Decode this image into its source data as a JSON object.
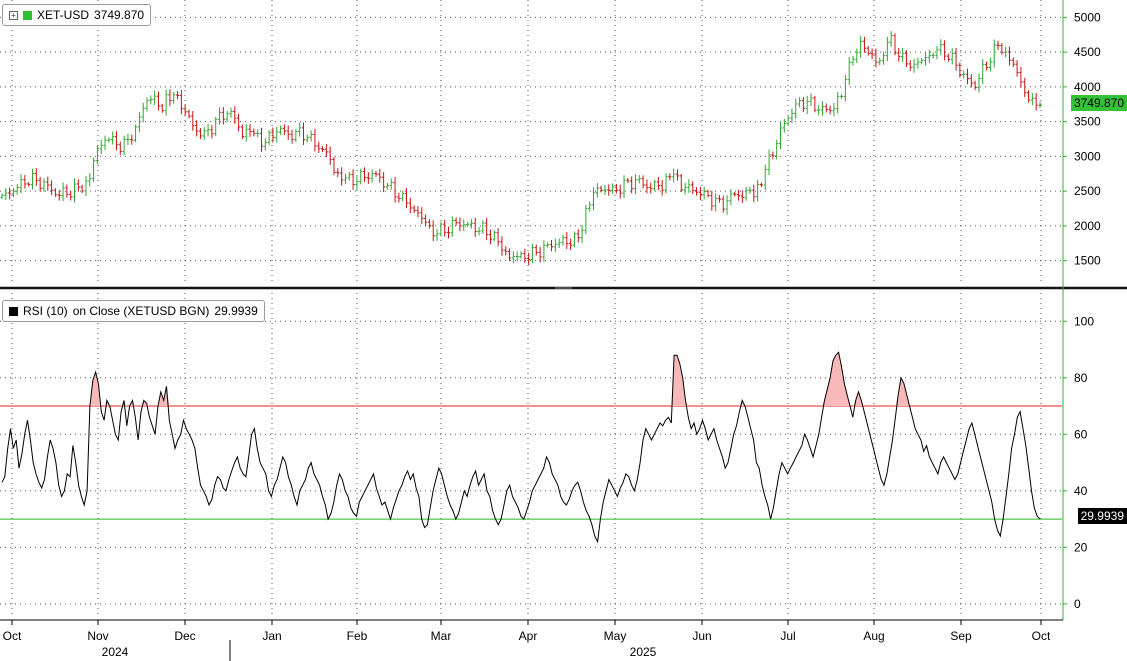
{
  "chart_data": [
    {
      "type": "candlestick",
      "legend": {
        "label": "XET-USD",
        "last_value": "3749.870",
        "color": "#2fc12f"
      },
      "last_tag": "3749.870",
      "ylim": [
        1150,
        5250
      ],
      "yticks": [
        1500,
        2000,
        2500,
        3000,
        3500,
        4000,
        4500,
        5000
      ],
      "up_color": "#2fa82f",
      "down_color": "#c81414",
      "x_points_per_month": 22,
      "close_series_monthly_anchors": [
        {
          "month": "Oct 2024",
          "values": [
            2400,
            2550,
            2680,
            2600,
            2450,
            2500
          ]
        },
        {
          "month": "Nov 2024",
          "values": [
            2600,
            3050,
            3300,
            3150,
            3200,
            3500,
            3900,
            3700
          ]
        },
        {
          "month": "Dec 2024",
          "values": [
            3900,
            3750,
            3400,
            3300,
            3550,
            3650,
            3350
          ]
        },
        {
          "month": "Jan 2025",
          "values": [
            3300,
            3200,
            3400,
            3300,
            3350,
            3200,
            3050
          ]
        },
        {
          "month": "Feb 2025",
          "values": [
            2750,
            2650,
            2700,
            2750,
            2600,
            2450,
            2300
          ]
        },
        {
          "month": "Mar 2025",
          "values": [
            2100,
            1900,
            1950,
            2050,
            2000,
            1950,
            1850
          ]
        },
        {
          "month": "Apr 2025",
          "values": [
            1600,
            1550,
            1580,
            1650,
            1750,
            1780,
            1800
          ]
        },
        {
          "month": "May 2025",
          "values": [
            2400,
            2550,
            2500,
            2600,
            2650,
            2550,
            2600
          ]
        },
        {
          "month": "Jun 2025",
          "values": [
            2700,
            2550,
            2500,
            2400,
            2300,
            2450,
            2450
          ]
        },
        {
          "month": "Jul 2025",
          "values": [
            2550,
            2950,
            3400,
            3700,
            3800,
            3700,
            3650
          ]
        },
        {
          "month": "Aug 2025",
          "values": [
            3900,
            4500,
            4600,
            4300,
            4700,
            4400,
            4300
          ]
        },
        {
          "month": "Sep 2025",
          "values": [
            4400,
            4550,
            4450,
            4200,
            4000,
            4300,
            4600
          ]
        },
        {
          "month": "Oct 2025",
          "values": [
            4450,
            4050,
            3749.87
          ]
        }
      ]
    },
    {
      "type": "line",
      "legend": {
        "label": "RSI (10)",
        "source": "on Close (XETUSD BGN)",
        "last_value": "29.9939",
        "color": "#000000"
      },
      "last_tag": "29.9939",
      "ylim": [
        -5,
        110
      ],
      "yticks": [
        0,
        20,
        40,
        60,
        80,
        100
      ],
      "overbought": 70,
      "oversold": 30,
      "overbought_color": "#e02020",
      "oversold_color": "#22bb22",
      "fill_color": "#f7b9b9",
      "rsi_values": [
        43,
        45,
        55,
        62,
        55,
        58,
        48,
        53,
        60,
        65,
        58,
        50,
        46,
        43,
        41,
        44,
        52,
        58,
        55,
        50,
        42,
        38,
        40,
        46,
        45,
        56,
        50,
        42,
        38,
        35,
        40,
        70,
        79,
        82,
        78,
        68,
        65,
        72,
        70,
        65,
        60,
        58,
        68,
        72,
        63,
        70,
        72,
        66,
        58,
        68,
        72,
        71,
        66,
        63,
        60,
        70,
        75,
        72,
        77,
        65,
        60,
        55,
        58,
        60,
        65,
        62,
        60,
        58,
        55,
        48,
        42,
        40,
        38,
        35,
        37,
        42,
        45,
        44,
        41,
        40,
        44,
        47,
        50,
        52,
        48,
        46,
        45,
        52,
        60,
        62,
        55,
        50,
        48,
        46,
        40,
        38,
        42,
        44,
        48,
        52,
        50,
        45,
        42,
        38,
        35,
        40,
        42,
        44,
        48,
        50,
        46,
        44,
        42,
        38,
        35,
        30,
        32,
        36,
        42,
        46,
        44,
        40,
        38,
        34,
        32,
        31,
        36,
        38,
        40,
        42,
        44,
        46,
        41,
        38,
        35,
        36,
        33,
        30,
        34,
        37,
        40,
        42,
        45,
        47,
        44,
        46,
        41,
        38,
        30,
        27,
        28,
        34,
        40,
        44,
        48,
        46,
        42,
        38,
        35,
        33,
        30,
        32,
        36,
        40,
        38,
        42,
        45,
        47,
        42,
        44,
        46,
        40,
        38,
        33,
        30,
        28,
        30,
        35,
        40,
        42,
        38,
        36,
        34,
        31,
        30,
        33,
        36,
        40,
        42,
        44,
        46,
        48,
        52,
        50,
        46,
        44,
        42,
        38,
        36,
        35,
        37,
        40,
        42,
        43,
        40,
        36,
        33,
        31,
        28,
        24,
        22,
        30,
        36,
        40,
        44,
        42,
        40,
        38,
        41,
        43,
        46,
        45,
        42,
        40,
        44,
        50,
        58,
        62,
        60,
        58,
        60,
        62,
        64,
        63,
        65,
        66,
        64,
        88,
        88,
        85,
        80,
        72,
        66,
        62,
        64,
        60,
        62,
        65,
        62,
        58,
        60,
        62,
        58,
        55,
        52,
        48,
        50,
        55,
        60,
        63,
        68,
        72,
        70,
        66,
        62,
        58,
        50,
        48,
        42,
        38,
        35,
        30,
        34,
        40,
        46,
        50,
        48,
        46,
        48,
        50,
        52,
        54,
        56,
        60,
        58,
        55,
        52,
        56,
        60,
        66,
        72,
        76,
        80,
        86,
        88,
        89,
        84,
        78,
        74,
        70,
        66,
        72,
        75,
        72,
        68,
        64,
        60,
        56,
        52,
        48,
        44,
        42,
        46,
        52,
        58,
        66,
        74,
        80,
        78,
        74,
        70,
        66,
        62,
        60,
        58,
        54,
        56,
        52,
        50,
        48,
        46,
        50,
        52,
        50,
        48,
        46,
        44,
        46,
        50,
        54,
        58,
        62,
        64,
        60,
        56,
        52,
        48,
        44,
        40,
        36,
        30,
        26,
        24,
        30,
        38,
        46,
        55,
        60,
        66,
        68,
        62,
        56,
        48,
        40,
        34,
        31,
        30
      ]
    }
  ],
  "x_axis": {
    "month_labels": [
      "Oct",
      "Nov",
      "Dec",
      "Jan",
      "Feb",
      "Mar",
      "Apr",
      "May",
      "Jun",
      "Jul",
      "Aug",
      "Sep",
      "Oct"
    ],
    "year_labels": [
      "2024",
      "2025"
    ]
  }
}
